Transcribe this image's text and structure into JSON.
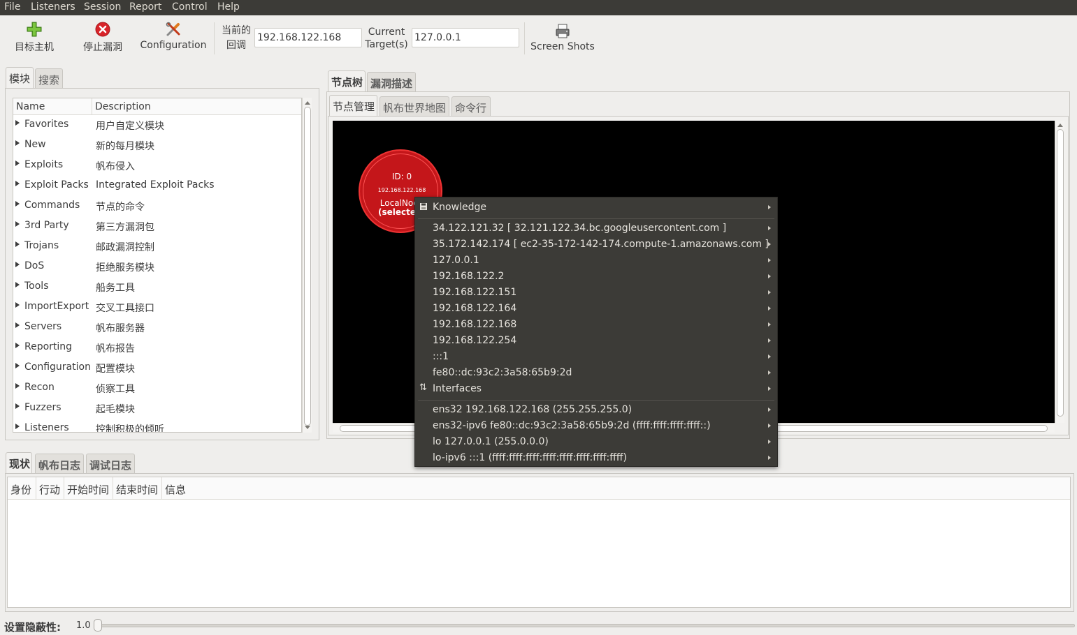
{
  "menubar": {
    "items": [
      "File",
      "Listeners",
      "Session",
      "Report",
      "Control",
      "Help"
    ]
  },
  "toolbar": {
    "target_host": "目标主机",
    "stop_exploit": "停止漏洞",
    "configuration": "Configuration",
    "current_callback_line1": "当前的",
    "current_callback_line2": "回调",
    "current_callback_value": "192.168.122.168",
    "current_target_line1": "Current",
    "current_target_line2": "Target(s)",
    "current_target_value": "127.0.0.1",
    "screenshots": "Screen Shots"
  },
  "left_tabs": [
    "模块",
    "搜索"
  ],
  "module_tree": {
    "headers": [
      "Name",
      "Description"
    ],
    "rows": [
      {
        "name": "Favorites",
        "desc": "用户自定义模块"
      },
      {
        "name": "New",
        "desc": "新的每月模块"
      },
      {
        "name": "Exploits",
        "desc": "帆布侵入"
      },
      {
        "name": "Exploit Packs",
        "desc": "Integrated Exploit Packs"
      },
      {
        "name": "Commands",
        "desc": "节点的命令"
      },
      {
        "name": "3rd Party",
        "desc": "第三方漏洞包"
      },
      {
        "name": "Trojans",
        "desc": "邮政漏洞控制"
      },
      {
        "name": "DoS",
        "desc": "拒绝服务模块"
      },
      {
        "name": "Tools",
        "desc": "船务工具"
      },
      {
        "name": "ImportExport",
        "desc": "交叉工具接口"
      },
      {
        "name": "Servers",
        "desc": "帆布服务器"
      },
      {
        "name": "Reporting",
        "desc": "帆布报告"
      },
      {
        "name": "Configuration",
        "desc": "配置模块"
      },
      {
        "name": "Recon",
        "desc": "侦察工具"
      },
      {
        "name": "Fuzzers",
        "desc": "起毛模块"
      },
      {
        "name": "Listeners",
        "desc": "控制积极的倾听"
      }
    ]
  },
  "right_tabs": [
    "节点树",
    "漏洞描述"
  ],
  "sub_tabs": [
    "节点管理",
    "帆布世界地图",
    "命令行"
  ],
  "node": {
    "id_label": "ID: 0",
    "ip": "192.168.122.168",
    "name": "LocalNode",
    "state": "(selected)"
  },
  "context_menu": {
    "knowledge_header": "Knowledge",
    "knowledge_items": [
      "34.122.121.32  [ 32.121.122.34.bc.googleusercontent.com ]",
      "35.172.142.174  [ ec2-35-172-142-174.compute-1.amazonaws.com ]",
      "127.0.0.1",
      "192.168.122.2",
      "192.168.122.151",
      "192.168.122.164",
      "192.168.122.168",
      "192.168.122.254",
      ":::1",
      "fe80::dc:93c2:3a58:65b9:2d"
    ],
    "interfaces_header": "Interfaces",
    "interface_items": [
      "ens32  192.168.122.168 (255.255.255.0)",
      "ens32-ipv6  fe80::dc:93c2:3a58:65b9:2d (ffff:ffff:ffff:ffff::)",
      "lo  127.0.0.1 (255.0.0.0)",
      "lo-ipv6  :::1 (ffff:ffff:ffff:ffff:ffff:ffff:ffff:ffff)"
    ]
  },
  "bottom_tabs": [
    "现状",
    "帆布日志",
    "调试日志"
  ],
  "status_table": {
    "headers": [
      "身份",
      "行动",
      "开始时间",
      "结束时间",
      "信息"
    ]
  },
  "stealth": {
    "label": "设置隐蔽性:",
    "value": "1.0",
    "level": 0.0
  },
  "colors": {
    "menubar_bg": "#3c3b37",
    "canvas_bg": "#000000",
    "node_fill": "#c4161a",
    "menu_bg": "#3c3b37"
  }
}
